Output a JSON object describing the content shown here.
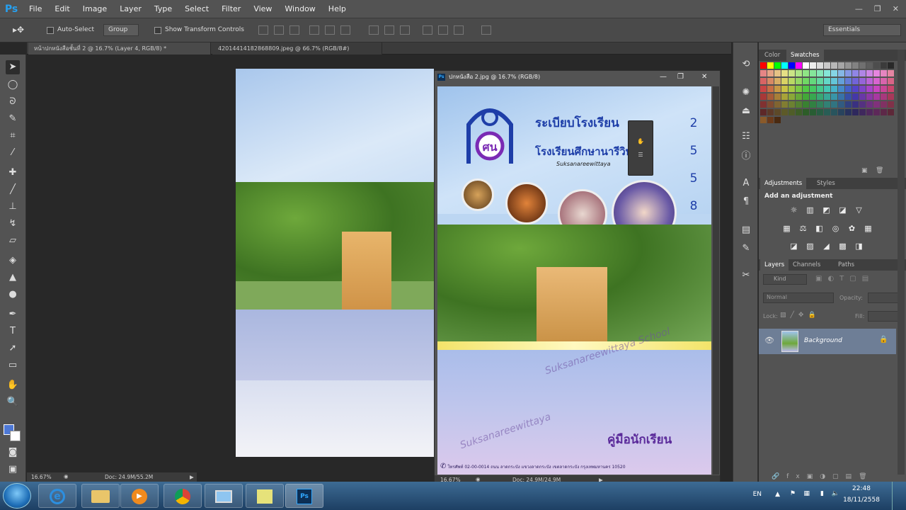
{
  "app": {
    "logo": "Ps"
  },
  "menu": [
    "File",
    "Edit",
    "Image",
    "Layer",
    "Type",
    "Select",
    "Filter",
    "View",
    "Window",
    "Help"
  ],
  "window_controls": {
    "minimize": "—",
    "restore": "❐",
    "close": "✕"
  },
  "options": {
    "auto_select_label": "Auto-Select",
    "group_value": "Group",
    "transform_label": "Show Transform Controls",
    "workspace": "Essentials"
  },
  "tabs": [
    {
      "label": "หน้าปกหนังสือชั้นที่ 2 @ 16.7% (Layer 4, RGB/8) *"
    },
    {
      "label": "42014414182868809.jpeg @ 66.7% (RGB/8#)"
    }
  ],
  "doc2": {
    "title": "ปกหนังสือ 2.jpg @ 16.7% (RGB/8)",
    "heading1": "ระเบียบโรงเรียน",
    "heading2": "โรงเรียนศึกษานารีวิทยา",
    "english": "Suksanareewittaya",
    "year_digits": [
      "2",
      "5",
      "5",
      "8"
    ],
    "watermark1": "Suksanareewittaya School",
    "watermark2": "Suksanareewittaya",
    "handbook": "คู่มือนักเรียน",
    "footer": "โทรศัพท์ 02-00-0014 ถนน ลาดกระบัง แขวงลาดกระบัง เขตลาดกระบัง กรุงเทพมหานคร 10520"
  },
  "status": {
    "zoom1": "16.67%",
    "doc1": "Doc: 24.9M/55.2M",
    "zoom2": "16.67%",
    "doc2": "Doc: 24.9M/24.9M"
  },
  "panels": {
    "swatch_tabs": [
      "Color",
      "Swatches"
    ],
    "adj_tabs": [
      "Adjustments",
      "Styles"
    ],
    "adj_heading": "Add an adjustment",
    "layer_tabs": [
      "Layers",
      "Channels",
      "Paths"
    ],
    "kind": "Kind",
    "blend": "Normal",
    "opacity_label": "Opacity:",
    "lock_label": "Lock:",
    "fill_label": "Fill:",
    "layer_name": "Background"
  },
  "tray": {
    "lang": "EN",
    "time": "22:48",
    "date": "18/11/2558"
  },
  "colors": {
    "ps_blue": "#26a0f0",
    "chrome": "#535353",
    "canvas_bg": "#282828"
  }
}
